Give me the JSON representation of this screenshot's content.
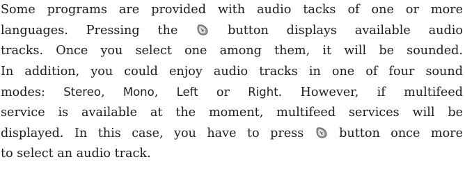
{
  "paragraph": {
    "l1": "Some programs are provided with audio tacks of one or more",
    "l2a": "languages. Pressing the",
    "l2b": "button displays available audio",
    "l3": "tracks. Once you select one among them, it will be sounded.",
    "l4": "In addition, you could enjoy audio tracks in one of four sound",
    "l5a": "modes:",
    "mode1": "Stereo",
    "sep1": ",",
    "mode2": "Mono",
    "sep2": ",",
    "mode3": "Left",
    "or": "or",
    "mode4": "Right",
    "l5b": ". However, if multifeed",
    "l6": "service is available at the moment, multifeed services will be",
    "l7a": "displayed. In this case, you have to press",
    "l7b": "button once more",
    "l8": "to select an audio track."
  },
  "icons": {
    "audio_button": "audio-button-icon",
    "color": "#8a8a8a"
  }
}
